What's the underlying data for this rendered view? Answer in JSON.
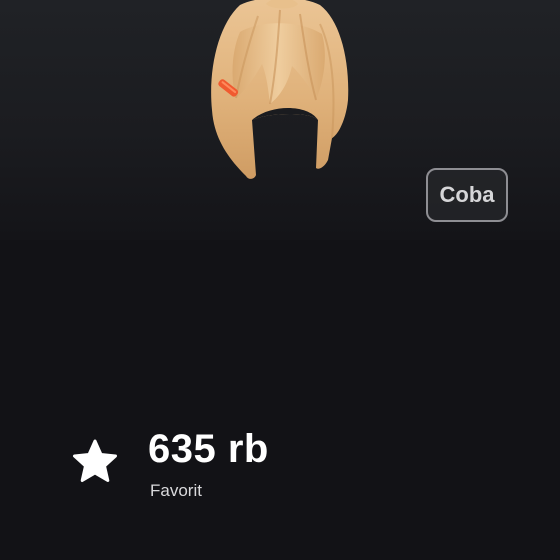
{
  "preview": {
    "item_image": "blonde-bob-hair-accessory",
    "try_button_label": "Coba"
  },
  "stats": {
    "favorites_icon": "star-icon",
    "favorites_count": "635 rb",
    "favorites_label": "Favorit"
  },
  "colors": {
    "background": "#121216",
    "hair": "#e2b882",
    "hair_clip": "#f05a30",
    "button_border": "#8e8e93"
  }
}
